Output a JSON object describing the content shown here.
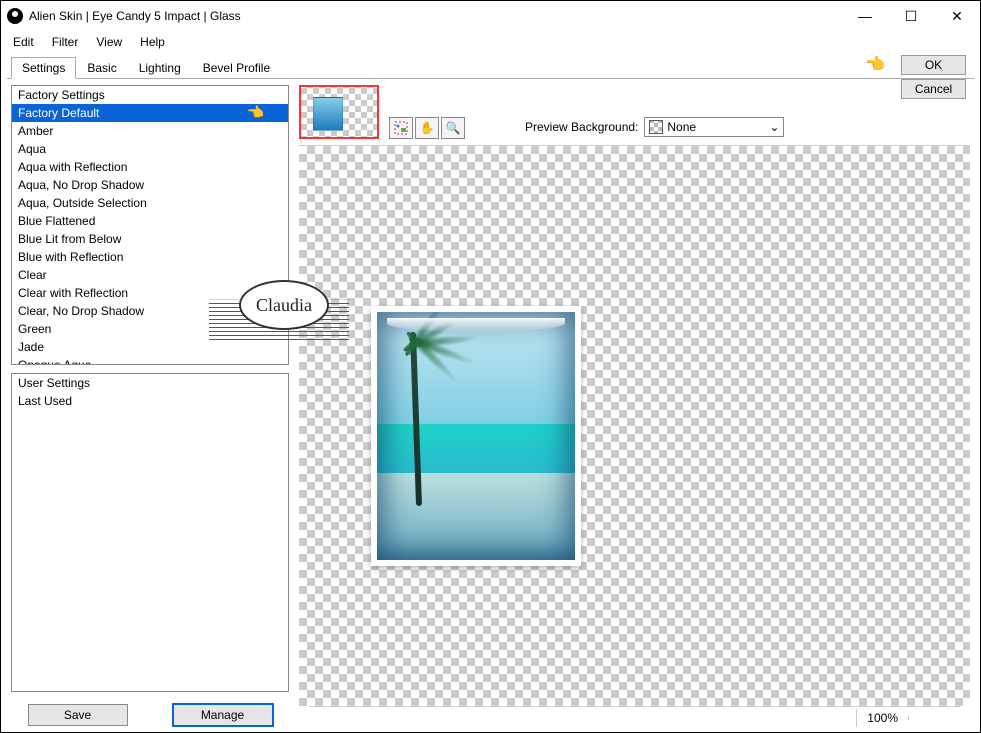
{
  "window": {
    "title": "Alien Skin | Eye Candy 5 Impact | Glass"
  },
  "menu": {
    "items": [
      "Edit",
      "Filter",
      "View",
      "Help"
    ]
  },
  "tabs": {
    "items": [
      "Settings",
      "Basic",
      "Lighting",
      "Bevel Profile"
    ],
    "active": 0
  },
  "buttons": {
    "ok": "OK",
    "cancel": "Cancel",
    "save": "Save",
    "manage": "Manage"
  },
  "factory_settings": {
    "header": "Factory Settings",
    "items": [
      "Factory Default",
      "Amber",
      "Aqua",
      "Aqua with Reflection",
      "Aqua, No Drop Shadow",
      "Aqua, Outside Selection",
      "Blue Flattened",
      "Blue Lit from Below",
      "Blue with Reflection",
      "Clear",
      "Clear with Reflection",
      "Clear, No Drop Shadow",
      "Green",
      "Jade",
      "Opaque Aqua"
    ],
    "selected": 0
  },
  "user_settings": {
    "header": "User Settings",
    "items": [
      "Last Used"
    ]
  },
  "preview": {
    "bg_label": "Preview Background:",
    "bg_value": "None"
  },
  "tools": {
    "hand_icon": "✋",
    "zoom_icon": "🔍",
    "move_icon": "↔"
  },
  "status": {
    "zoom": "100%"
  },
  "watermark": {
    "text": "Claudia"
  }
}
